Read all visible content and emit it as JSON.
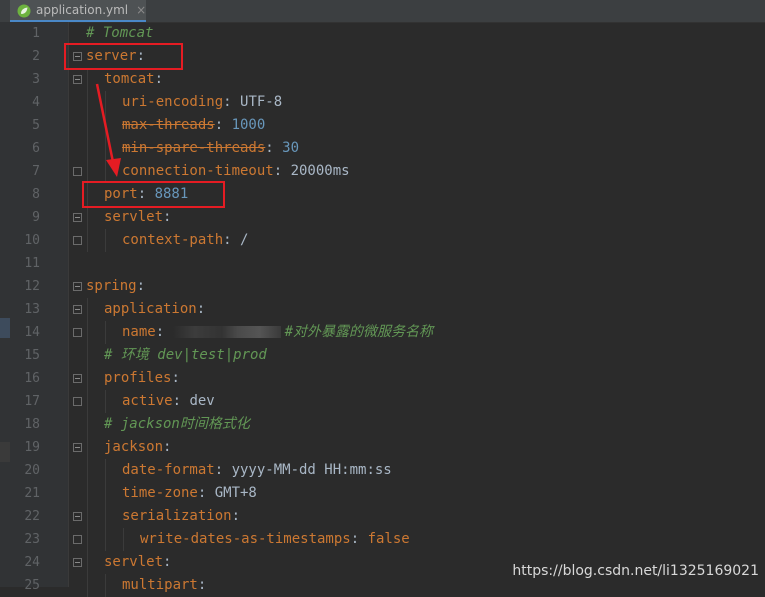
{
  "tab": {
    "title": "application.yml",
    "close": "×",
    "icon": "spring-leaf-icon"
  },
  "lines": [
    {
      "n": "1",
      "indent": 0,
      "parts": [
        {
          "t": "# Tomcat",
          "c": "c"
        }
      ]
    },
    {
      "n": "2",
      "indent": 0,
      "fold": "open",
      "parts": [
        {
          "t": "server",
          "c": "k"
        },
        {
          "t": ":",
          "c": "p"
        }
      ]
    },
    {
      "n": "3",
      "indent": 1,
      "fold": "open",
      "parts": [
        {
          "t": "tomcat",
          "c": "k"
        },
        {
          "t": ":",
          "c": "p"
        }
      ]
    },
    {
      "n": "4",
      "indent": 2,
      "parts": [
        {
          "t": "uri-encoding",
          "c": "k"
        },
        {
          "t": ": ",
          "c": "p"
        },
        {
          "t": "UTF-8",
          "c": "v"
        }
      ]
    },
    {
      "n": "5",
      "indent": 2,
      "parts": [
        {
          "t": "max-threads",
          "c": "k strike"
        },
        {
          "t": ": ",
          "c": "p"
        },
        {
          "t": "1000",
          "c": "n"
        }
      ]
    },
    {
      "n": "6",
      "indent": 2,
      "parts": [
        {
          "t": "min-spare-threads",
          "c": "k strike"
        },
        {
          "t": ": ",
          "c": "p"
        },
        {
          "t": "30",
          "c": "n"
        }
      ]
    },
    {
      "n": "7",
      "indent": 2,
      "fold": "end",
      "parts": [
        {
          "t": "connection-timeout",
          "c": "k"
        },
        {
          "t": ": ",
          "c": "p"
        },
        {
          "t": "20000ms",
          "c": "v"
        }
      ]
    },
    {
      "n": "8",
      "indent": 1,
      "parts": [
        {
          "t": "port",
          "c": "k"
        },
        {
          "t": ": ",
          "c": "p"
        },
        {
          "t": "8881",
          "c": "n"
        }
      ]
    },
    {
      "n": "9",
      "indent": 1,
      "fold": "open",
      "parts": [
        {
          "t": "servlet",
          "c": "k"
        },
        {
          "t": ":",
          "c": "p"
        }
      ]
    },
    {
      "n": "10",
      "indent": 2,
      "fold": "end",
      "parts": [
        {
          "t": "context-path",
          "c": "k"
        },
        {
          "t": ": ",
          "c": "p"
        },
        {
          "t": "/",
          "c": "v"
        }
      ]
    },
    {
      "n": "11",
      "indent": 0,
      "parts": []
    },
    {
      "n": "12",
      "indent": 0,
      "fold": "open",
      "parts": [
        {
          "t": "spring",
          "c": "k"
        },
        {
          "t": ":",
          "c": "p"
        }
      ]
    },
    {
      "n": "13",
      "indent": 1,
      "fold": "open",
      "parts": [
        {
          "t": "application",
          "c": "k"
        },
        {
          "t": ":",
          "c": "p"
        }
      ]
    },
    {
      "n": "14",
      "indent": 2,
      "fold": "end",
      "parts": [
        {
          "t": "name",
          "c": "k"
        },
        {
          "t": ": ",
          "c": "p"
        },
        {
          "t": "",
          "c": "blur"
        },
        {
          "t": "#对外暴露的微服务名称",
          "c": "c"
        }
      ]
    },
    {
      "n": "15",
      "indent": 1,
      "parts": [
        {
          "t": "# 环境 dev|test|prod",
          "c": "c"
        }
      ]
    },
    {
      "n": "16",
      "indent": 1,
      "fold": "open",
      "parts": [
        {
          "t": "profiles",
          "c": "k"
        },
        {
          "t": ":",
          "c": "p"
        }
      ]
    },
    {
      "n": "17",
      "indent": 2,
      "fold": "end",
      "parts": [
        {
          "t": "active",
          "c": "k"
        },
        {
          "t": ": ",
          "c": "p"
        },
        {
          "t": "dev",
          "c": "v"
        }
      ]
    },
    {
      "n": "18",
      "indent": 1,
      "parts": [
        {
          "t": "# jackson时间格式化",
          "c": "c"
        }
      ]
    },
    {
      "n": "19",
      "indent": 1,
      "fold": "open",
      "parts": [
        {
          "t": "jackson",
          "c": "k"
        },
        {
          "t": ":",
          "c": "p"
        }
      ]
    },
    {
      "n": "20",
      "indent": 2,
      "parts": [
        {
          "t": "date-format",
          "c": "k"
        },
        {
          "t": ": ",
          "c": "p"
        },
        {
          "t": "yyyy-MM-dd HH:mm:ss",
          "c": "v"
        }
      ]
    },
    {
      "n": "21",
      "indent": 2,
      "parts": [
        {
          "t": "time-zone",
          "c": "k"
        },
        {
          "t": ": ",
          "c": "p"
        },
        {
          "t": "GMT+8",
          "c": "v"
        }
      ]
    },
    {
      "n": "22",
      "indent": 2,
      "fold": "open",
      "parts": [
        {
          "t": "serialization",
          "c": "k"
        },
        {
          "t": ":",
          "c": "p"
        }
      ]
    },
    {
      "n": "23",
      "indent": 3,
      "fold": "end",
      "parts": [
        {
          "t": "write-dates-as-timestamps",
          "c": "k"
        },
        {
          "t": ": ",
          "c": "p"
        },
        {
          "t": "false",
          "c": "k"
        }
      ]
    },
    {
      "n": "24",
      "indent": 1,
      "fold": "open",
      "parts": [
        {
          "t": "servlet",
          "c": "k"
        },
        {
          "t": ":",
          "c": "p"
        }
      ]
    },
    {
      "n": "25",
      "indent": 2,
      "parts": [
        {
          "t": "multipart",
          "c": "k"
        },
        {
          "t": ":",
          "c": "p"
        }
      ]
    }
  ],
  "annotations": {
    "color": "#e51c23"
  },
  "watermark": "https://blog.csdn.net/li1325169021"
}
